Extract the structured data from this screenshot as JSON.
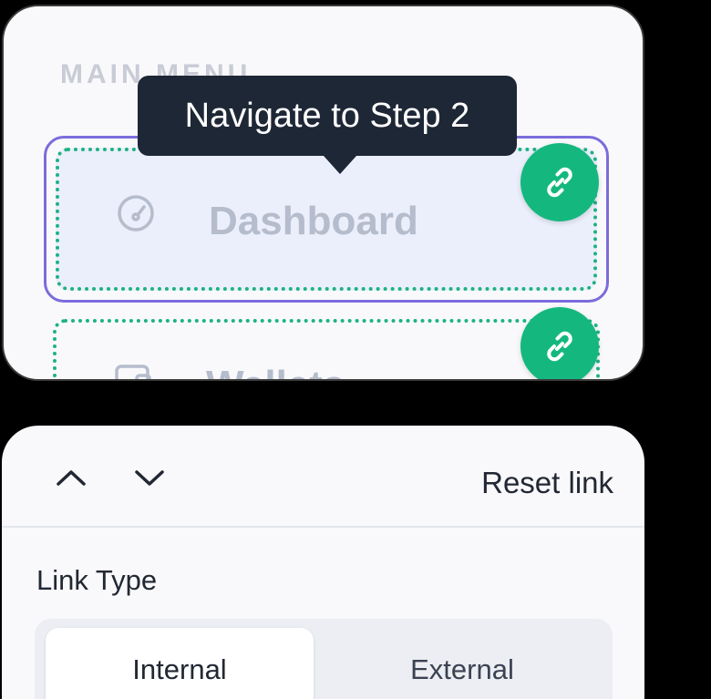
{
  "menu": {
    "heading": "MAIN MENU",
    "items": [
      {
        "label": "Dashboard",
        "icon": "gauge-icon",
        "state": "selected"
      },
      {
        "label": "Wallets",
        "icon": "wallet-icon",
        "state": "default"
      }
    ],
    "tooltip": "Navigate to Step 2"
  },
  "panel": {
    "reset_label": "Reset link",
    "link_type_label": "Link Type",
    "options": [
      "Internal",
      "External"
    ],
    "selected_option": "Internal"
  },
  "colors": {
    "accent_green": "#14b87f",
    "selection_outline": "#7b6cdc",
    "tooltip_bg": "#1e2736"
  }
}
